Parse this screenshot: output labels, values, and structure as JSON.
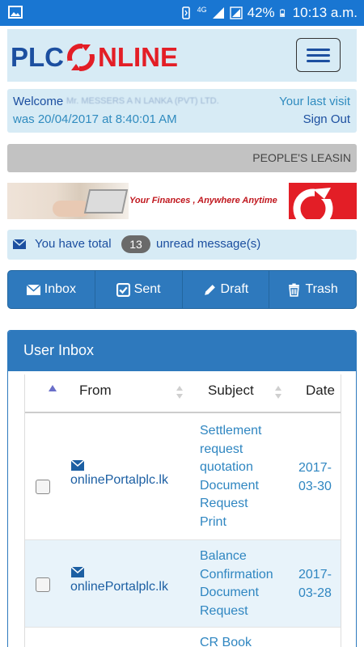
{
  "status_bar": {
    "network": "4G",
    "battery": "42%",
    "time": "10:13 a.m."
  },
  "header": {
    "logo_left": "PLC",
    "logo_right": "NLINE",
    "menu_icon": "hamburger-icon"
  },
  "welcome": {
    "label": "Welcome",
    "name": "Mr. MESSERS A N LANKA (PVT) LTD.",
    "last_visit_label": "Your last visit",
    "last_visit": "was 20/04/2017 at 8:40:01 AM",
    "sign_out": "Sign Out"
  },
  "marquee": {
    "text": "PEOPLE'S LEASIN"
  },
  "banner": {
    "tagline": "Your Finances , Anywhere Anytime"
  },
  "notice": {
    "prefix": "You have total",
    "count": "13",
    "suffix": "unread message(s)"
  },
  "folders": [
    {
      "label": "Inbox",
      "icon": "envelope-icon"
    },
    {
      "label": "Sent",
      "icon": "check-square-icon"
    },
    {
      "label": "Draft",
      "icon": "pencil-icon"
    },
    {
      "label": "Trash",
      "icon": "trash-icon"
    }
  ],
  "inbox": {
    "title": "User Inbox",
    "columns": {
      "from": "From",
      "subject": "Subject",
      "date": "Date"
    },
    "rows": [
      {
        "from": "onlinePortalplc.lk",
        "subject_lines": [
          "Settlement",
          "request",
          "quotation",
          "Document",
          "Request",
          "Print"
        ],
        "date_lines": [
          "2017-",
          "03-30"
        ]
      },
      {
        "from": "onlinePortalplc.lk",
        "subject_lines": [
          "Balance",
          "Confirmation",
          "Document",
          "Request"
        ],
        "date_lines": [
          "2017-",
          "03-28"
        ]
      },
      {
        "from": "",
        "subject_lines": [
          "CR Book"
        ],
        "date_lines": []
      }
    ]
  },
  "colors": {
    "status_bar": "#1976d2",
    "header_bg": "#d7ebf5",
    "logo_blue": "#1c4fa0",
    "logo_red": "#e31e26",
    "button_blue": "#2e79bd",
    "link_blue": "#2f86c1"
  }
}
